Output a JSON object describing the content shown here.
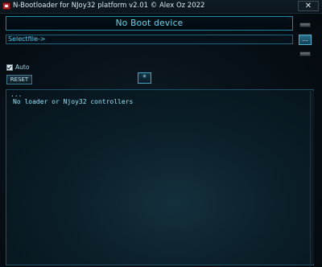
{
  "window": {
    "title": "N-Bootloader for NJoy32 platform v2.01 © Alex Oz 2022",
    "close_glyph": "✕"
  },
  "device": {
    "status": "No Boot device"
  },
  "file": {
    "label": "Selectfile->",
    "browse_label": "..."
  },
  "options": {
    "auto_label": "Auto",
    "auto_checked": true
  },
  "buttons": {
    "reset_label": "RESET",
    "star_label": "*"
  },
  "log": {
    "lines": [
      "...",
      "No loader or Njoy32 controllers"
    ]
  },
  "colors": {
    "accent": "#5fd8f2",
    "border": "#1e8aa8",
    "app_icon": "#b4232a"
  }
}
